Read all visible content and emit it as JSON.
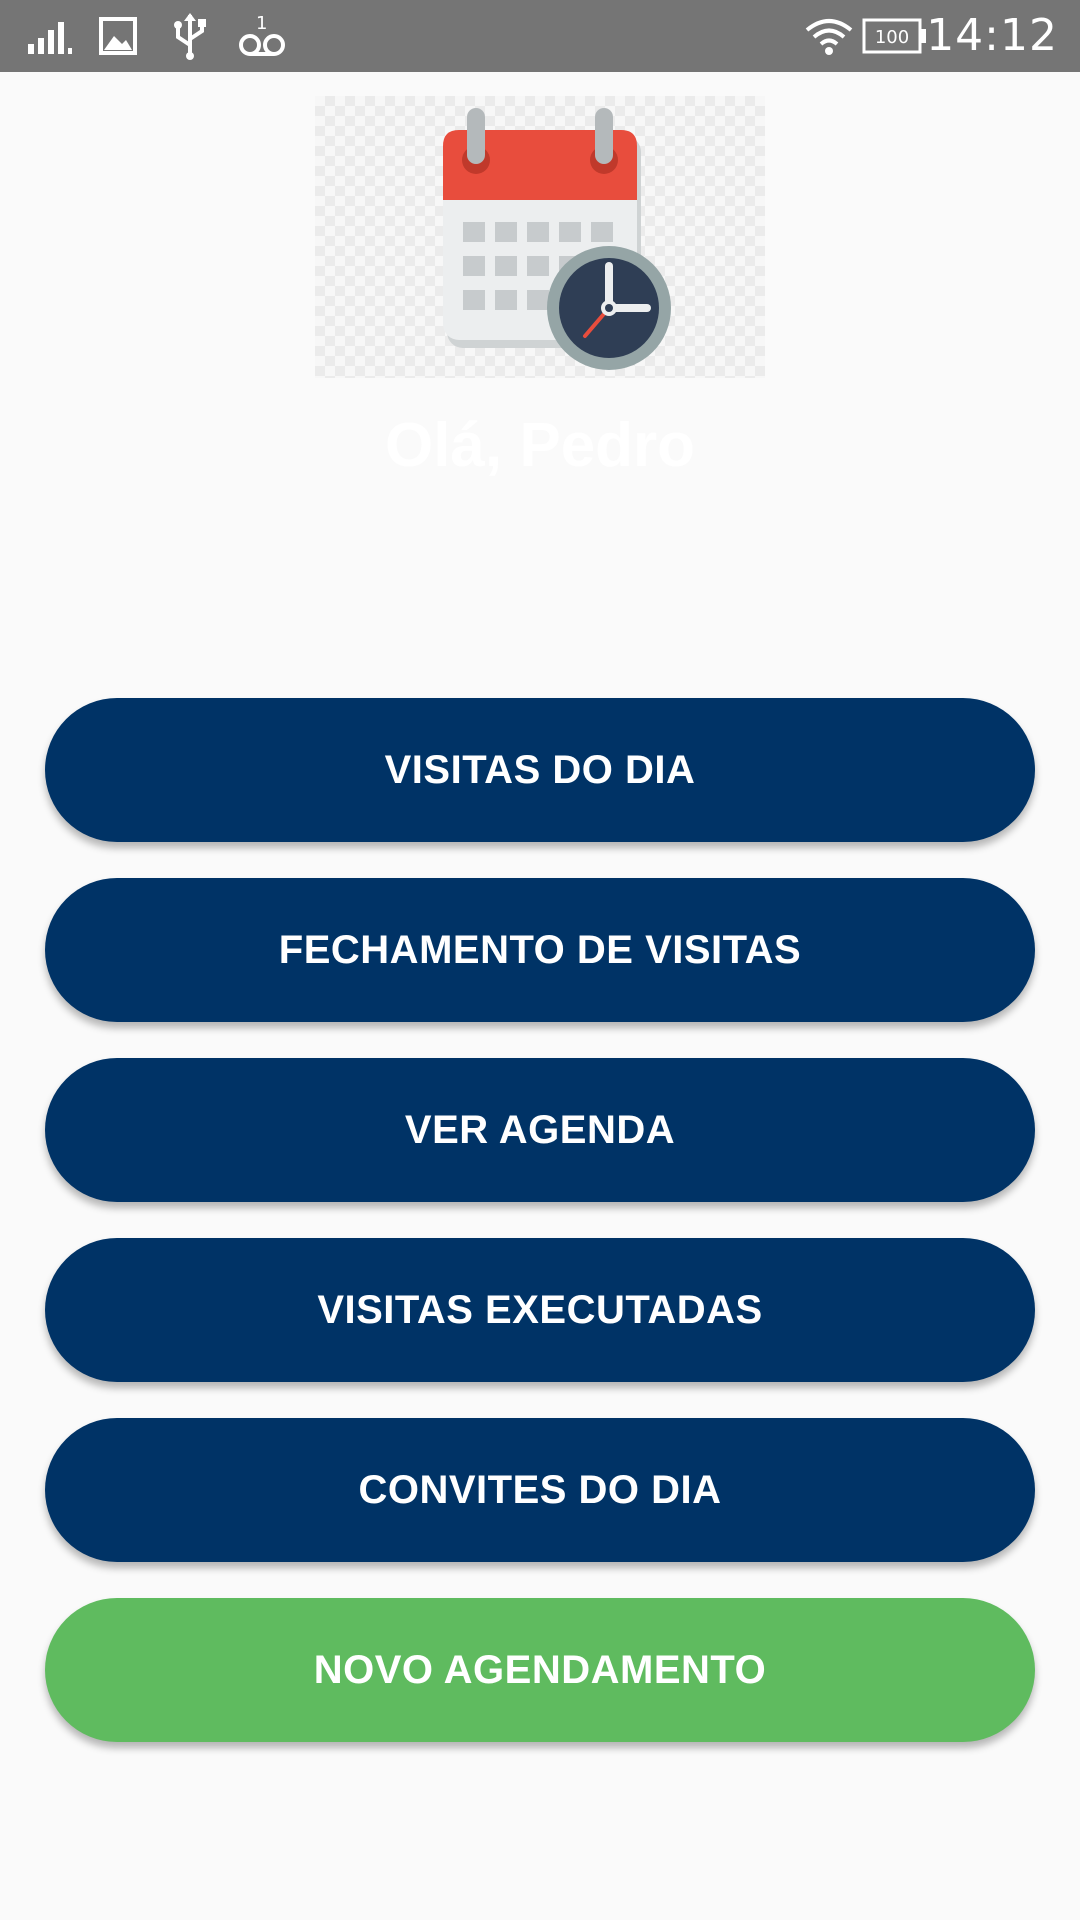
{
  "status_bar": {
    "time": "14:12",
    "battery": "100",
    "icons": [
      "signal-icon",
      "image-icon",
      "usb-icon",
      "voicemail-icon",
      "wifi-icon",
      "battery-icon"
    ]
  },
  "header": {
    "logo_icon": "calendar-clock-icon",
    "greeting": "Olá, Pedro"
  },
  "menu": {
    "visitas_do_dia": "VISITAS DO DIA",
    "fechamento_de_visitas": "FECHAMENTO DE VISITAS",
    "ver_agenda": "VER AGENDA",
    "visitas_executadas": "VISITAS EXECUTADAS",
    "convites_do_dia": "CONVITES DO DIA",
    "novo_agendamento": "NOVO AGENDAMENTO"
  },
  "colors": {
    "status_bar": "#757575",
    "primary_button": "#003366",
    "accent_button": "#5fbb5f",
    "background": "#fafafa"
  }
}
